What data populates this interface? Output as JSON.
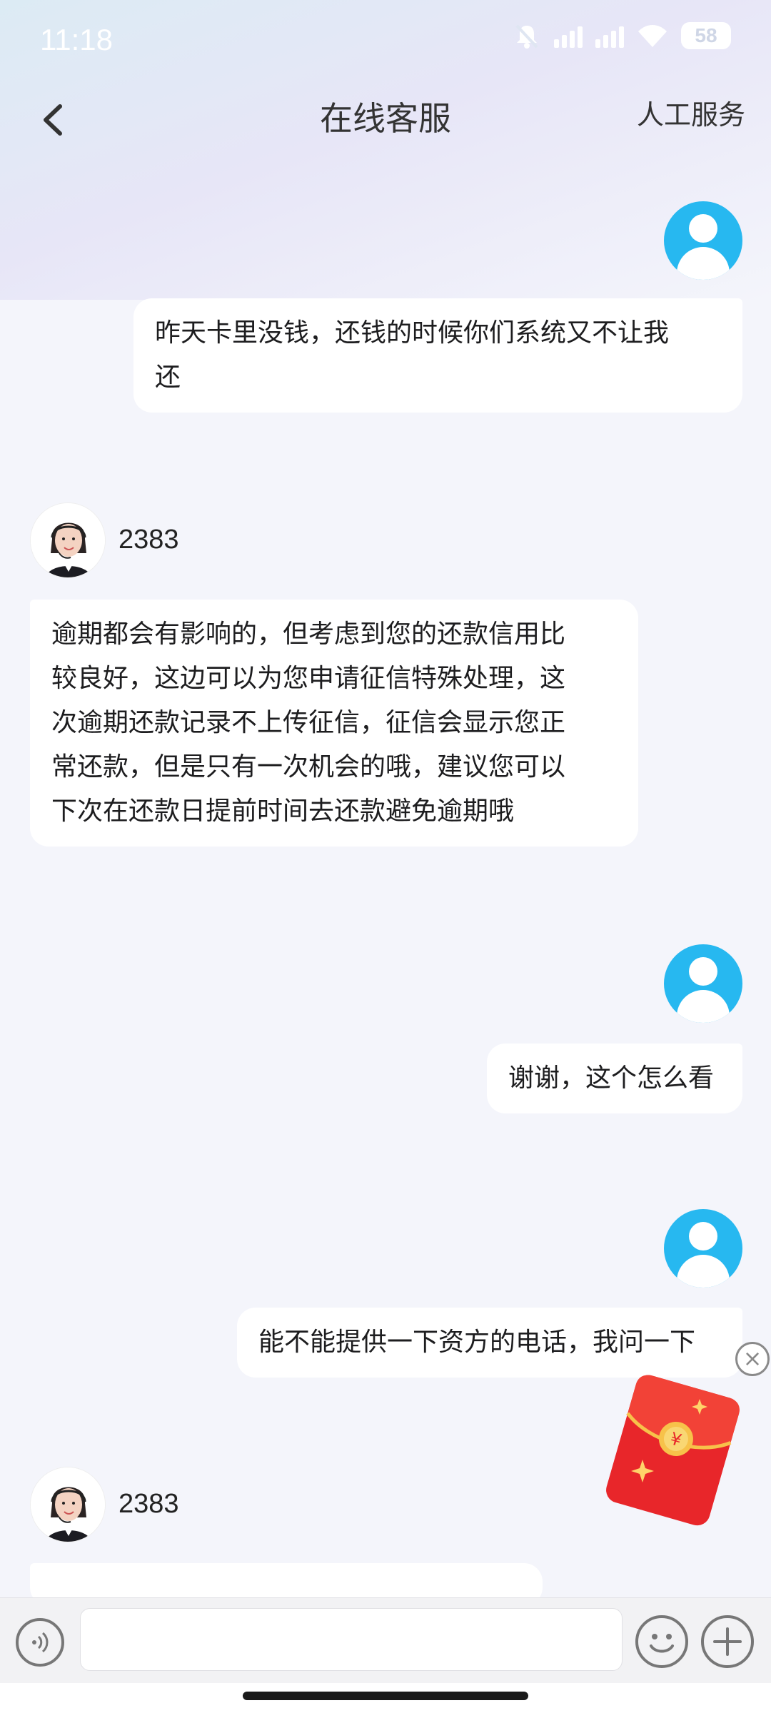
{
  "status_bar": {
    "time": "11:18",
    "battery": "58",
    "icons": [
      "bell-muted-icon",
      "signal-icon",
      "signal-icon",
      "wifi-icon",
      "battery-icon"
    ]
  },
  "header": {
    "title": "在线客服",
    "human_service": "人工服务",
    "back_icon": "chevron-left-icon"
  },
  "messages": [
    {
      "from": "user",
      "text_lines": [
        "昨天卡里没钱，还钱的时候你们系统又不让我",
        "还"
      ]
    },
    {
      "from": "agent",
      "agent_id": "2383",
      "text_lines": [
        "逾期都会有影响的，但考虑到您的还款信用比",
        "较良好，这边可以为您申请征信特殊处理，这",
        "次逾期还款记录不上传征信，征信会显示您正",
        "常还款，但是只有一次机会的哦，建议您可以",
        "下次在还款日提前时间去还款避免逾期哦"
      ]
    },
    {
      "from": "user",
      "text_lines": [
        "谢谢，这个怎么看"
      ]
    },
    {
      "from": "user",
      "text_lines": [
        "能不能提供一下资方的电话，我问一下"
      ]
    },
    {
      "from": "agent",
      "agent_id": "2383",
      "text_lines": [
        ""
      ]
    }
  ],
  "redpacket": {
    "symbol": "¥"
  },
  "input_bar": {
    "placeholder": "",
    "voice_icon": "voice-icon",
    "emoji_icon": "emoji-icon",
    "plus_icon": "plus-icon"
  },
  "colors": {
    "user_avatar": "#27b8f0",
    "bubble": "#ffffff",
    "background": "#f4f5fb",
    "redpacket": "#e8262a"
  }
}
